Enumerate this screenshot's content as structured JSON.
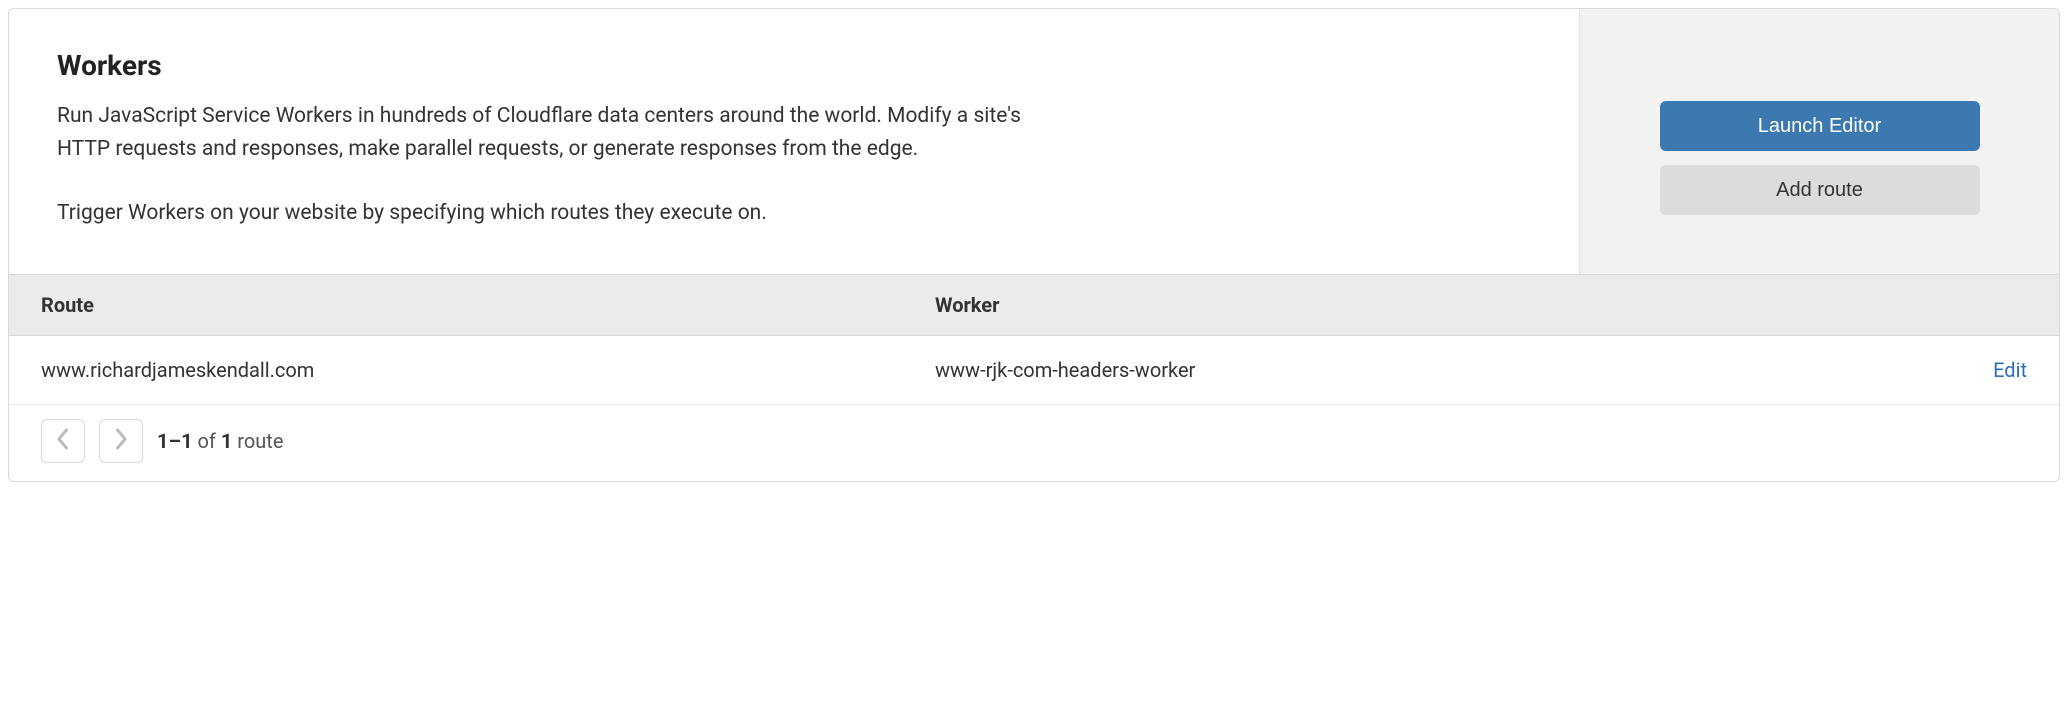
{
  "header": {
    "title": "Workers",
    "description_p1": "Run JavaScript Service Workers in hundreds of Cloudflare data centers around the world. Modify a site's HTTP requests and responses, make parallel requests, or generate responses from the edge.",
    "description_p2": "Trigger Workers on your website by specifying which routes they execute on."
  },
  "actions": {
    "launch_editor": "Launch Editor",
    "add_route": "Add route"
  },
  "table": {
    "columns": {
      "route": "Route",
      "worker": "Worker"
    },
    "rows": [
      {
        "route": "www.richardjameskendall.com",
        "worker": "www-rjk-com-headers-worker",
        "edit_label": "Edit"
      }
    ]
  },
  "pager": {
    "range": "1–1",
    "of": " of ",
    "total": "1",
    "suffix": " route"
  }
}
